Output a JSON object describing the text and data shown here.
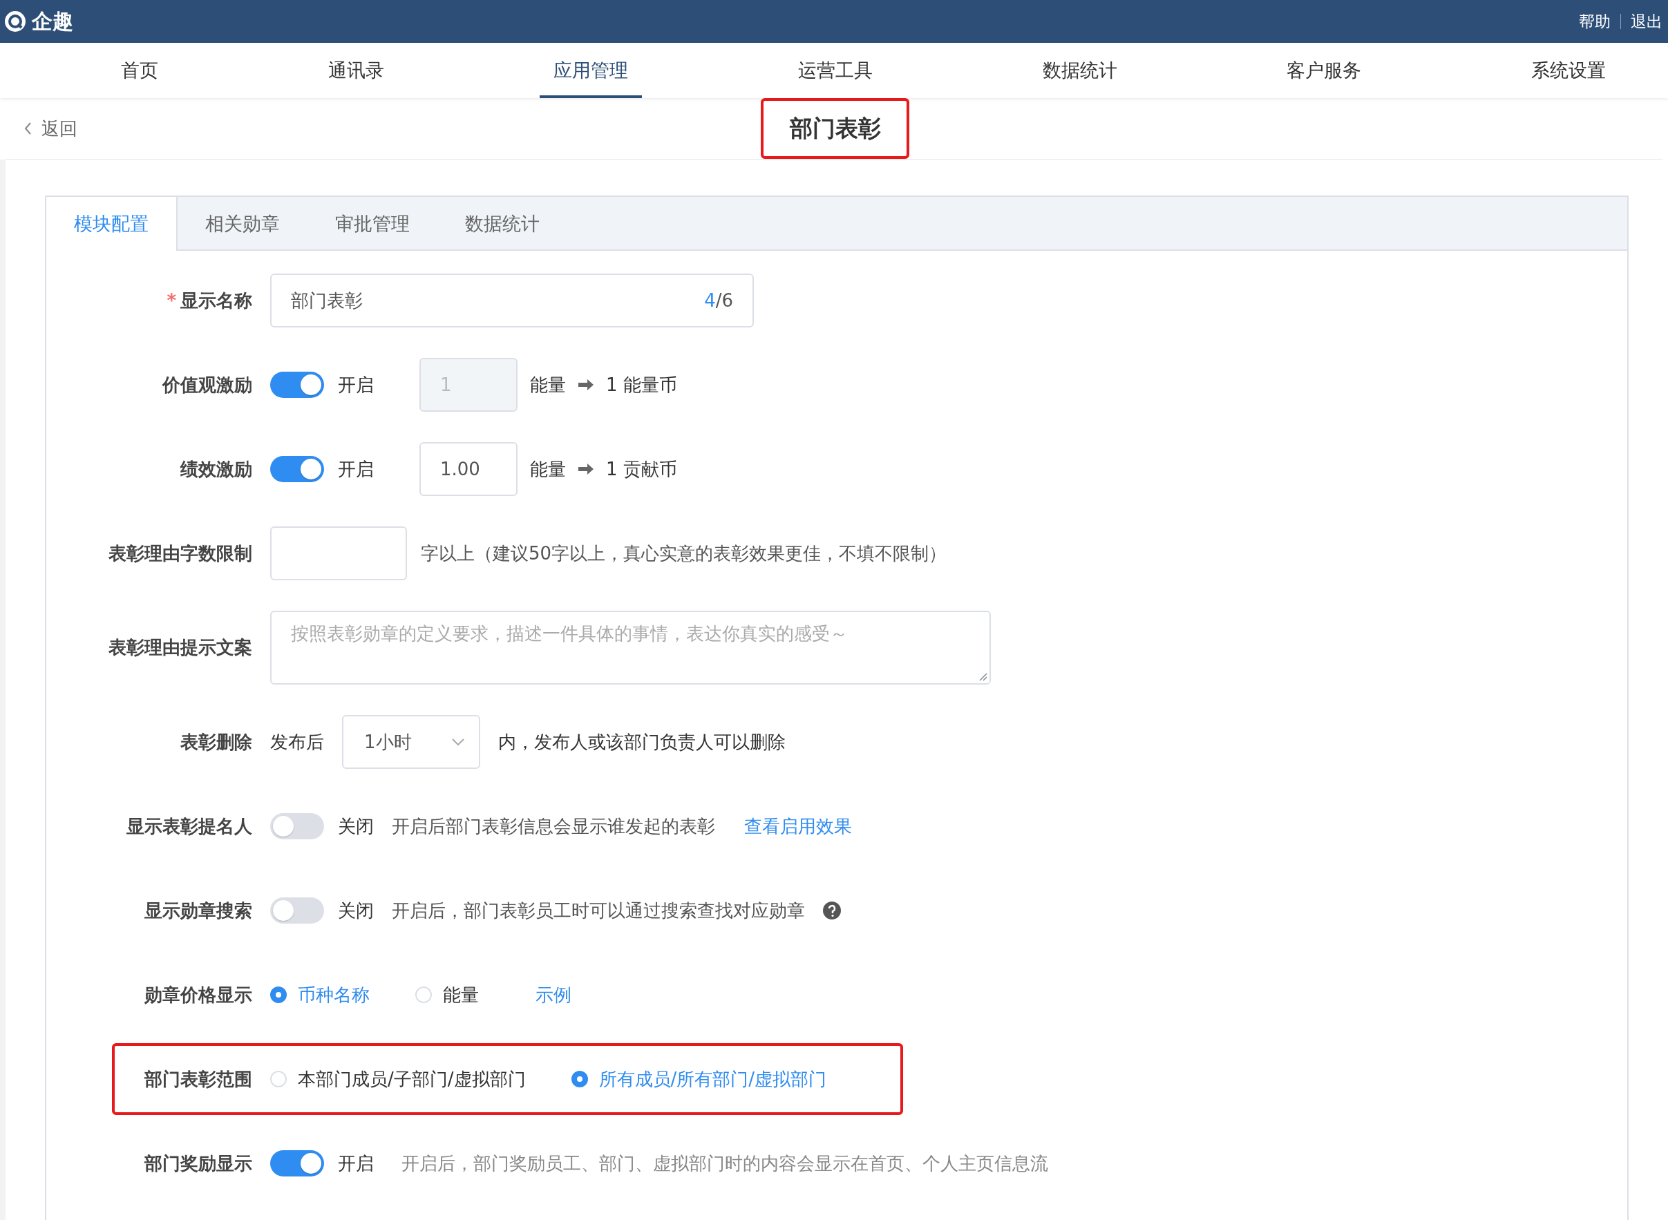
{
  "header": {
    "logo": "企趣",
    "links": [
      "帮助",
      "退出"
    ]
  },
  "nav": [
    {
      "label": "首页",
      "selected": false
    },
    {
      "label": "通讯录",
      "selected": false
    },
    {
      "label": "应用管理",
      "selected": true
    },
    {
      "label": "运营工具",
      "selected": false
    },
    {
      "label": "数据统计",
      "selected": false
    },
    {
      "label": "客户服务",
      "selected": false
    },
    {
      "label": "系统设置",
      "selected": false
    }
  ],
  "back": "返回",
  "page_title": {
    "text": "部门表彰",
    "highlighted": true
  },
  "tabs": [
    {
      "label": "模块配置",
      "selected": true
    },
    {
      "label": "相关勋章",
      "selected": false
    },
    {
      "label": "审批管理",
      "selected": false
    },
    {
      "label": "数据统计",
      "selected": false
    }
  ],
  "form": [
    {
      "kind": "text",
      "label": "显示名称",
      "required_mark": "*",
      "value": "部门表彰",
      "count": "4",
      "limit": "/6"
    },
    {
      "kind": "rate",
      "label": "价值观激励",
      "on": true,
      "state_text": "开启",
      "amount": "1",
      "disabled": true,
      "unit": "能量",
      "result": "1 能量币"
    },
    {
      "kind": "rate",
      "label": "绩效激励",
      "on": true,
      "state_text": "开启",
      "amount": "1.00",
      "disabled": false,
      "unit": "能量",
      "result": "1 贡献币"
    },
    {
      "kind": "number",
      "label": "表彰理由字数限制",
      "hint": "字以上（建议50字以上，真心实意的表彰效果更佳，不填不限制）"
    },
    {
      "kind": "textarea",
      "label": "表彰理由提示文案",
      "placeholder": "按照表彰勋章的定义要求，描述一件具体的事情，表达你真实的感受～"
    },
    {
      "kind": "select",
      "label": "表彰删除",
      "prefix": "发布后",
      "value": "1小时",
      "suffix": "内，发布人或该部门负责人可以删除"
    },
    {
      "kind": "toggle",
      "label": "显示表彰提名人",
      "on": false,
      "state_text": "关闭",
      "hint": "开启后部门表彰信息会显示谁发起的表彰",
      "link": "查看启用效果"
    },
    {
      "kind": "toggle",
      "label": "显示勋章搜索",
      "on": false,
      "state_text": "关闭",
      "hint": "开启后，部门表彰员工时可以通过搜索查找对应勋章",
      "help": true
    },
    {
      "kind": "radio",
      "label": "勋章价格显示",
      "options": [
        {
          "label": "币种名称",
          "selected": true
        },
        {
          "label": "能量",
          "selected": false
        }
      ],
      "link": "示例"
    },
    {
      "kind": "radio",
      "label": "部门表彰范围",
      "highlighted": true,
      "options": [
        {
          "label": "本部门成员/子部门/虚拟部门",
          "selected": false
        },
        {
          "label": "所有成员/所有部门/虚拟部门",
          "selected": true
        }
      ]
    },
    {
      "kind": "toggle",
      "label": "部门奖励显示",
      "on": true,
      "state_text": "开启",
      "hint": "开启后，部门奖励员工、部门、虚拟部门时的内容会显示在首页、个人主页信息流",
      "muted_hint": true
    }
  ]
}
